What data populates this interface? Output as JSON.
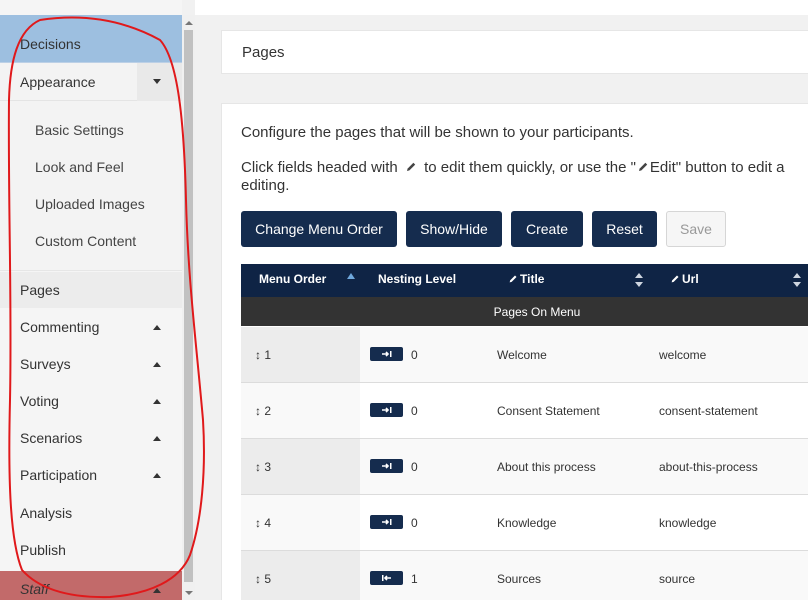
{
  "sidebar": {
    "decisions": "Decisions",
    "appearance": "Appearance",
    "sub_items": [
      "Basic Settings",
      "Look and Feel",
      "Uploaded Images",
      "Custom Content"
    ],
    "pages": "Pages",
    "commenting": "Commenting",
    "surveys": "Surveys",
    "voting": "Voting",
    "scenarios": "Scenarios",
    "participation": "Participation",
    "analysis": "Analysis",
    "publish": "Publish",
    "staff": "Staff"
  },
  "header": {
    "title": "Pages"
  },
  "main": {
    "intro": "Configure the pages that will be shown to your participants.",
    "instr_before": "Click fields headed with",
    "instr_middle": "to edit them quickly, or use the \"",
    "instr_edit": "Edit\" button to edit a",
    "instr_line2": "editing."
  },
  "buttons": {
    "change_menu_order": "Change Menu Order",
    "show_hide": "Show/Hide",
    "create": "Create",
    "reset": "Reset",
    "save": "Save"
  },
  "table": {
    "headers": {
      "menu_order": "Menu Order",
      "nesting_level": "Nesting Level",
      "title": "Title",
      "url": "Url"
    },
    "group": "Pages On Menu",
    "rows": [
      {
        "order": "1",
        "nesting": "0",
        "title": "Welcome",
        "url": "welcome"
      },
      {
        "order": "2",
        "nesting": "0",
        "title": "Consent Statement",
        "url": "consent-statement"
      },
      {
        "order": "3",
        "nesting": "0",
        "title": "About this process",
        "url": "about-this-process"
      },
      {
        "order": "4",
        "nesting": "0",
        "title": "Knowledge",
        "url": "knowledge"
      },
      {
        "order": "5",
        "nesting": "1",
        "title": "Sources",
        "url": "source"
      }
    ]
  },
  "colors": {
    "navy": "#152c4e",
    "header_navy": "#0f2445",
    "decisions_blue": "#9dbfe0",
    "staff_red": "#c26a6a",
    "annotation_red": "#e0191b"
  }
}
